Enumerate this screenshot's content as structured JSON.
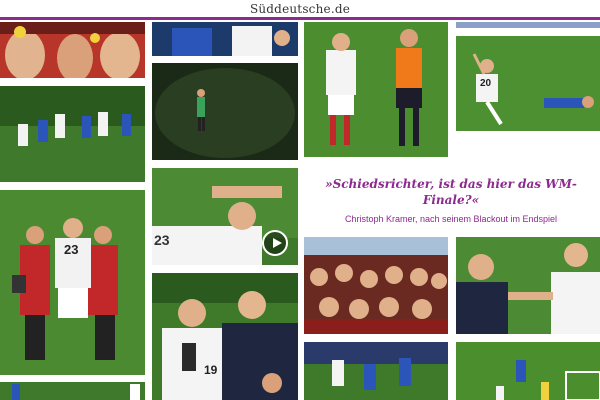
{
  "site": {
    "logo_text": "Süddeutsche.de"
  },
  "quote": {
    "text": "»Schiedsrichter, ist das hier das WM-Finale?«",
    "attribution": "Christoph Kramer, nach seinem Blackout im Endspiel"
  },
  "gallery": {
    "accent_color": "#8c2a8f",
    "player_numbers": [
      "23",
      "20",
      "23",
      "19"
    ],
    "video_tile": {
      "icon": "play-icon"
    }
  }
}
